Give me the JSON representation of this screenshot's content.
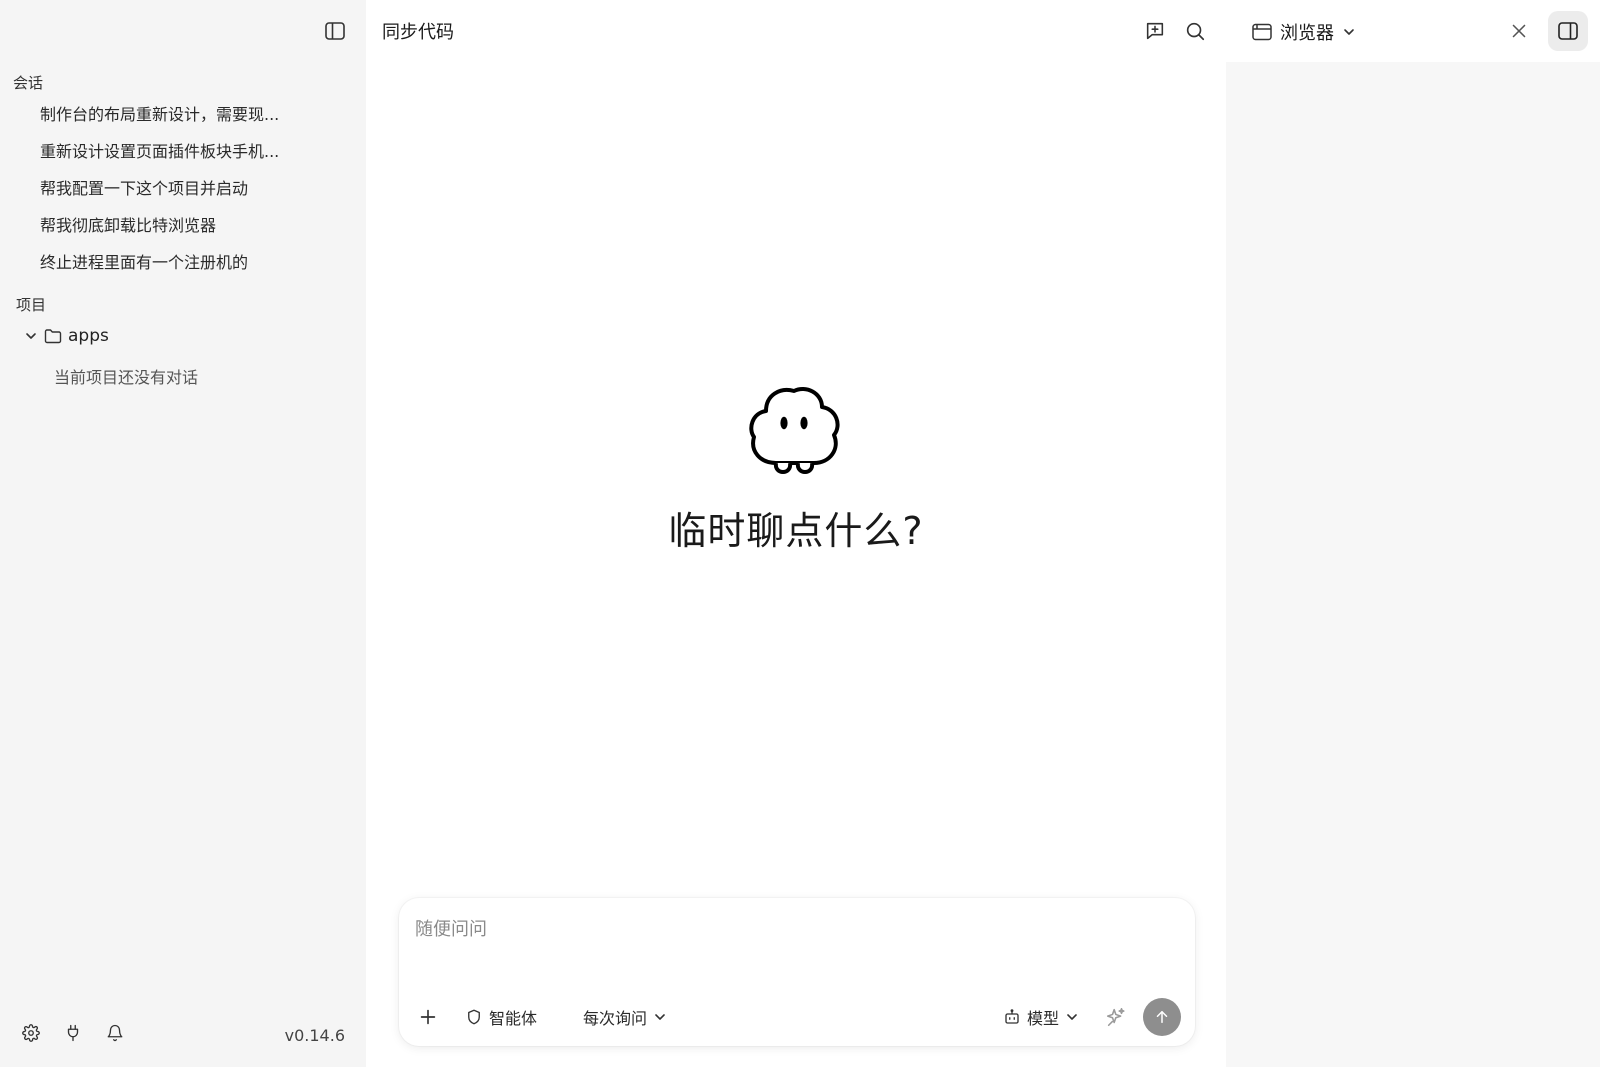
{
  "sidebar": {
    "sessions_label": "会话",
    "sessions": [
      {
        "title": "制作台的布局重新设计，需要现..."
      },
      {
        "title": "重新设计设置页面插件板块手机..."
      },
      {
        "title": "帮我配置一下这个项目并启动"
      },
      {
        "title": "帮我彻底卸载比特浏览器"
      },
      {
        "title": "终止进程里面有一个注册机的"
      }
    ],
    "projects_label": "项目",
    "project": {
      "name": "apps",
      "empty_text": "当前项目还没有对话"
    },
    "footer": {
      "version": "v0.14.6",
      "icons": [
        "settings-icon",
        "plug-icon",
        "bell-icon"
      ]
    }
  },
  "main": {
    "title": "同步代码",
    "hero_text": "临时聊点什么?",
    "composer": {
      "placeholder": "随便问问",
      "value": "",
      "agent_label": "智能体",
      "mode_label": "每次询问",
      "model_label": "模型"
    }
  },
  "right_panel": {
    "tab_label": "浏览器"
  },
  "colors": {
    "sidebar_bg": "#f5f5f5",
    "send_button": "#8e8e8e",
    "panel_body": "#f7f7f7"
  }
}
